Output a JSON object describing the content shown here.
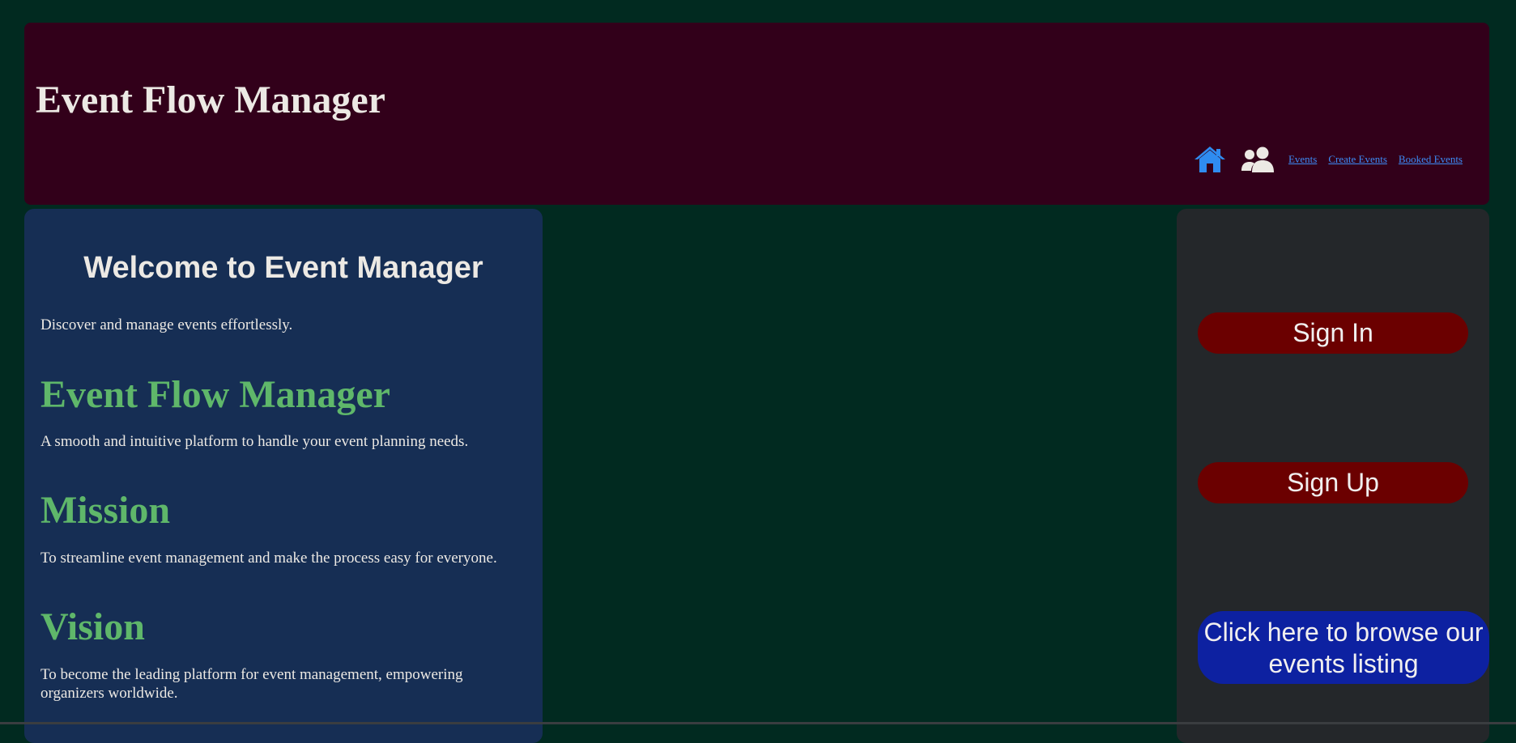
{
  "header": {
    "title": "Event Flow Manager",
    "nav_links": [
      "Events",
      "Create Events",
      "Booked Events"
    ],
    "icons": [
      "home-icon",
      "users-icon"
    ]
  },
  "left_panel": {
    "welcome_title": "Welcome to Event Manager",
    "welcome_text": "Discover and manage events effortlessly.",
    "about_title": "Event Flow Manager",
    "about_text": "A smooth and intuitive platform to handle your event planning needs.",
    "mission_title": "Mission",
    "mission_text": "To streamline event management and make the process easy for everyone.",
    "vision_title": "Vision",
    "vision_text": "To become the leading platform for event management, empowering organizers worldwide."
  },
  "right_panel": {
    "sign_in": "Sign In",
    "sign_up": "Sign Up",
    "browse_events": "Click here to browse our events listing"
  },
  "colors": {
    "page_bg": "#012a20",
    "header_bg": "#32001a",
    "left_panel_bg": "#162e54",
    "right_panel_bg": "#24272a",
    "accent_green": "#5fb76a",
    "button_red": "#6b0000",
    "button_blue": "#0d21a1",
    "link_blue": "#3d8bf5"
  }
}
